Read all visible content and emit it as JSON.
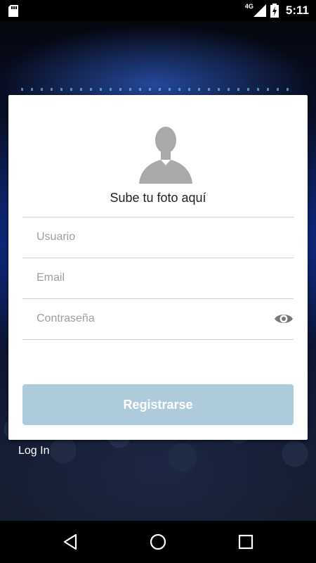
{
  "status_bar": {
    "time": "5:11",
    "network": "4G",
    "icons": [
      "sd-card-icon",
      "signal-icon",
      "battery-charging-icon"
    ]
  },
  "form": {
    "photo_label": "Sube tu foto aquí",
    "username_placeholder": "Usuario",
    "email_placeholder": "Email",
    "password_placeholder": "Contraseña",
    "register_label": "Registrarse",
    "register_color": "#aecbdb"
  },
  "footer": {
    "login_label": "Log In"
  },
  "nav_bar": {
    "icons": [
      "back-icon",
      "home-icon",
      "recents-icon"
    ]
  }
}
